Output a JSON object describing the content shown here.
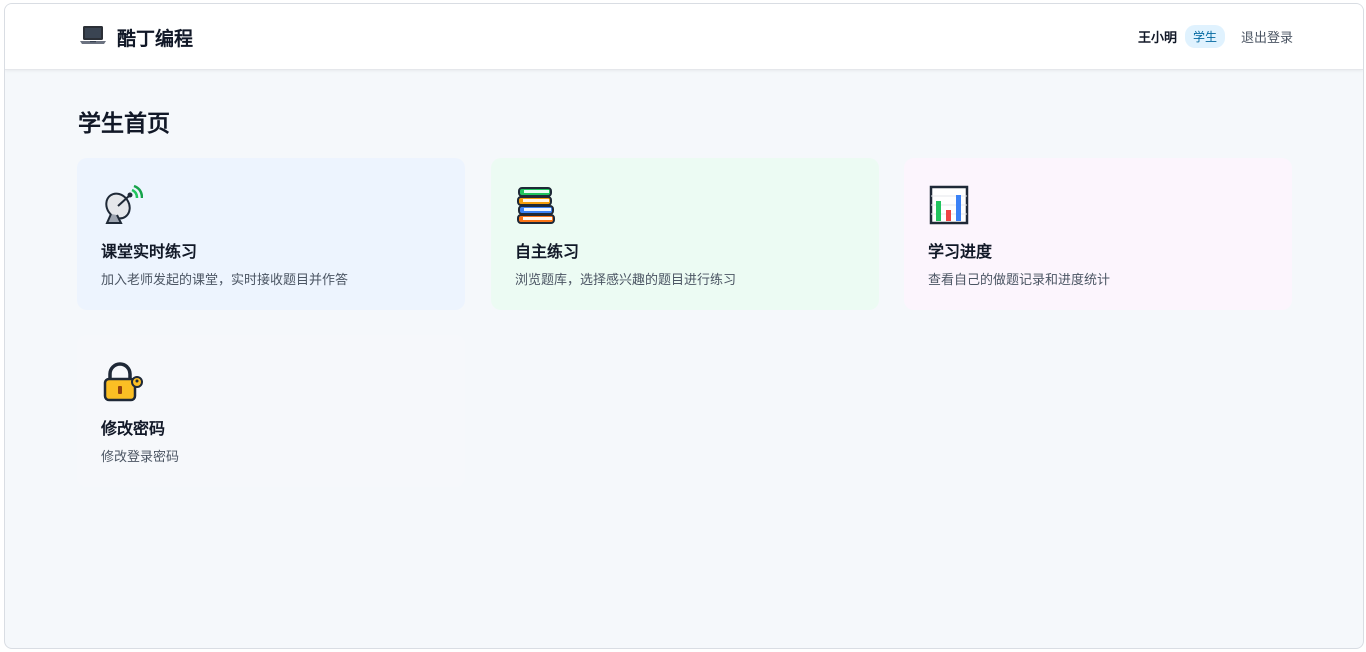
{
  "header": {
    "brand_icon": "laptop-icon",
    "brand_title": "酷丁编程",
    "user_name": "王小明",
    "role_badge": "学生",
    "logout_label": "退出登录"
  },
  "page": {
    "title": "学生首页"
  },
  "cards": [
    {
      "icon": "satellite-dish-icon",
      "title": "课堂实时练习",
      "desc": "加入老师发起的课堂，实时接收题目并作答",
      "bg": "#edf4fe"
    },
    {
      "icon": "books-icon",
      "title": "自主练习",
      "desc": "浏览题库，选择感兴趣的题目进行练习",
      "bg": "#ecfbf3"
    },
    {
      "icon": "bar-chart-icon",
      "title": "学习进度",
      "desc": "查看自己的做题记录和进度统计",
      "bg": "#fcf5fd"
    },
    {
      "icon": "lock-key-icon",
      "title": "修改密码",
      "desc": "修改登录密码",
      "bg": "#f6f8fb"
    }
  ],
  "colors": {
    "accent": "#0369a1",
    "badge_bg": "#e0f2fe",
    "page_bg": "#f5f8fb"
  }
}
